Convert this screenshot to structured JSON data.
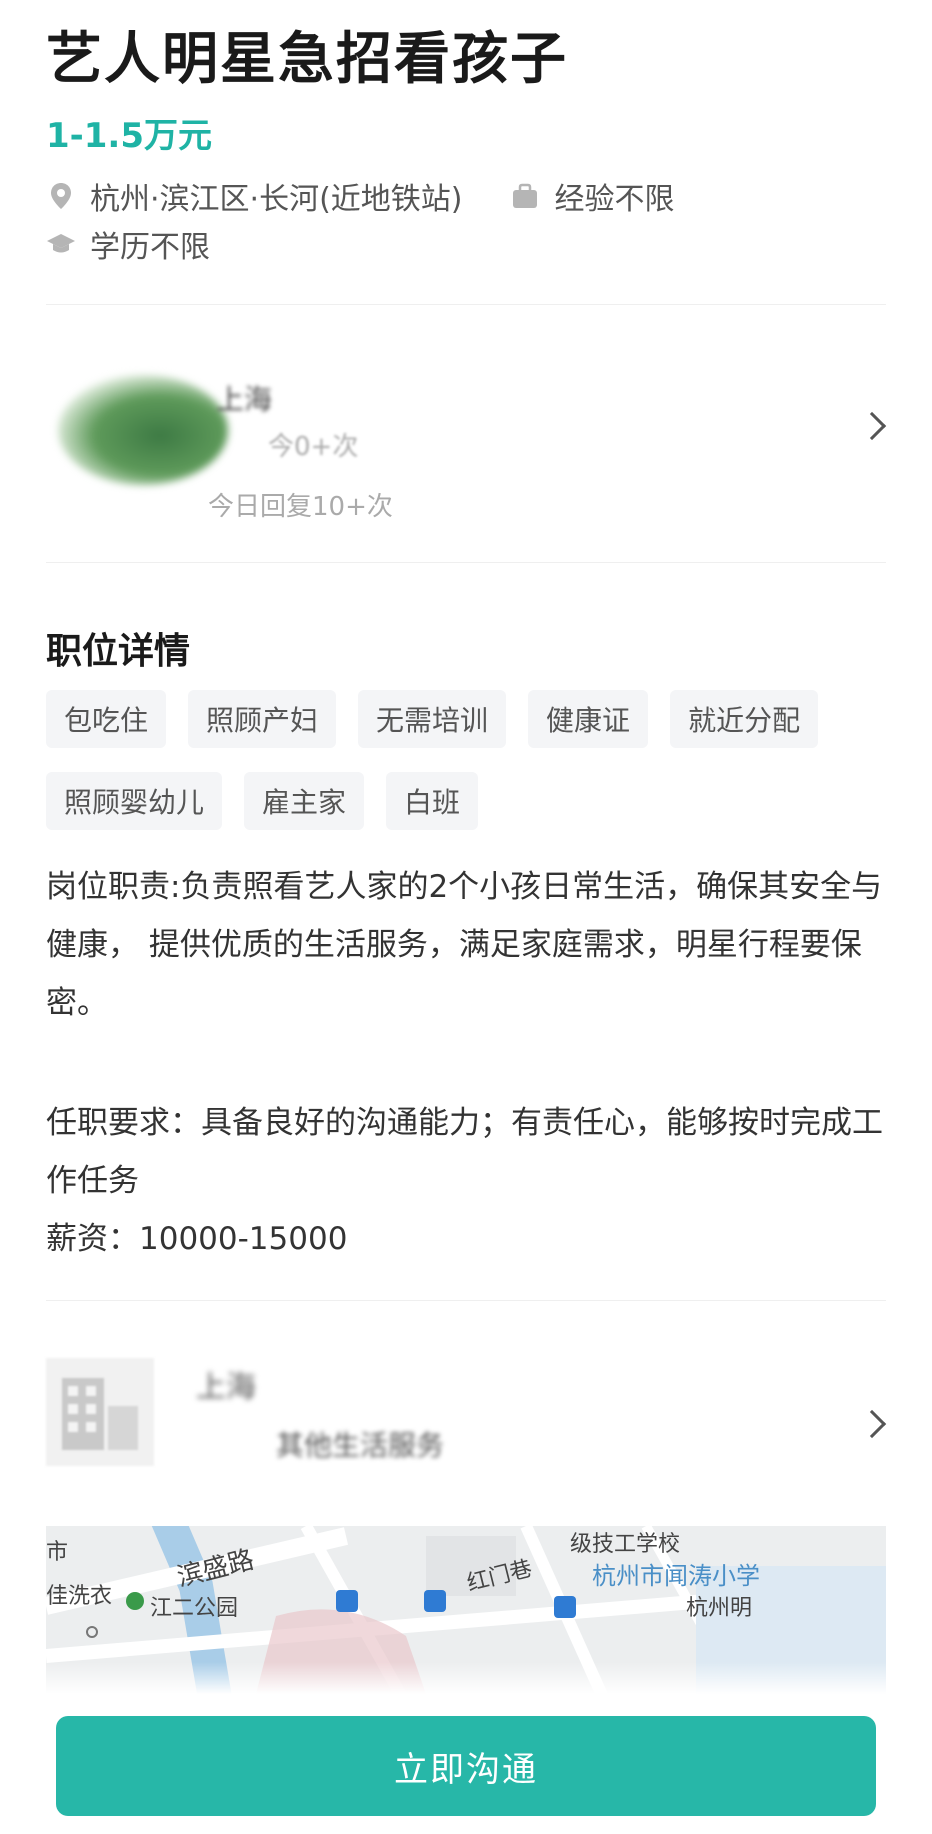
{
  "job": {
    "title": "艺人明星急招看孩子",
    "salary": "1-1.5万元",
    "location": "杭州·滨江区·长河(近地铁站)",
    "experience": "经验不限",
    "education": "学历不限"
  },
  "recruiter": {
    "name": "上海",
    "active": "今0+次",
    "reply": "今日回复10+次"
  },
  "details": {
    "section_title": "职位详情",
    "tags": [
      "包吃住",
      "照顾产妇",
      "无需培训",
      "健康证",
      "就近分配",
      "照顾婴幼儿",
      "雇主家",
      "白班"
    ],
    "duty": "岗位职责:负责照看艺人家的2个小孩日常生活，确保其安全与健康， 提供优质的生活服务，满足家庭需求，明星行程要保密。",
    "requirement": "任职要求：具备良好的沟通能力；有责任心，能够按时完成工作任务",
    "pay": "薪资：10000-15000"
  },
  "company": {
    "name": "上海",
    "subtitle": "其他生活服务"
  },
  "map": {
    "labels": {
      "road_binsheng": "滨盛路",
      "park": "江二公园",
      "hongmen_lane": "红门巷",
      "school_tech": "级技工学校",
      "school_wentao": "杭州市闻涛小学",
      "hz_ming": "杭州明",
      "market": "市",
      "laundry": "佳洗衣"
    }
  },
  "cta": {
    "label": "立即沟通"
  },
  "colors": {
    "accent": "#27b7a8",
    "salary": "#1fb3a5"
  }
}
